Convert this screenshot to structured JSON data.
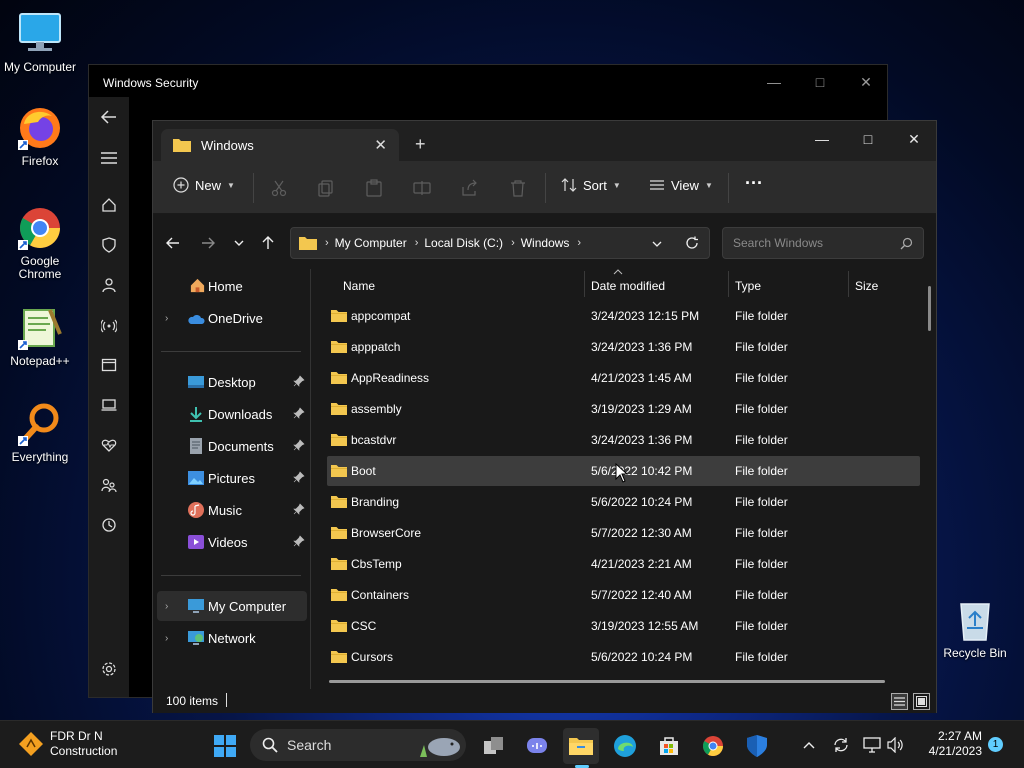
{
  "desktop": {
    "icons": [
      {
        "label": "My Computer",
        "icon": "monitor-icon"
      },
      {
        "label": "Firefox",
        "icon": "firefox-icon"
      },
      {
        "label": "Google Chrome",
        "icon": "chrome-icon"
      },
      {
        "label": "Notepad++",
        "icon": "notepadpp-icon"
      },
      {
        "label": "Everything",
        "icon": "everything-icon"
      },
      {
        "label": "Recycle Bin",
        "icon": "recycle-bin-icon"
      }
    ]
  },
  "security_window": {
    "title": "Windows Security",
    "sidebar_icons": [
      "back-arrow-icon",
      "menu-icon",
      "home-icon",
      "shield-icon",
      "account-icon",
      "wifi-icon",
      "app-browser-icon",
      "device-icon",
      "health-icon",
      "family-icon",
      "history-icon",
      "settings-icon"
    ]
  },
  "explorer": {
    "tab_title": "Windows",
    "toolbar": {
      "new_label": "New",
      "sort_label": "Sort",
      "view_label": "View",
      "more_label": "···"
    },
    "address": {
      "breadcrumbs": [
        "My Computer",
        "Local Disk (C:)",
        "Windows"
      ]
    },
    "search_placeholder": "Search Windows",
    "nav": {
      "home": "Home",
      "onedrive": "OneDrive",
      "desktop": "Desktop",
      "downloads": "Downloads",
      "documents": "Documents",
      "pictures": "Pictures",
      "music": "Music",
      "videos": "Videos",
      "my_computer": "My Computer",
      "network": "Network"
    },
    "columns": {
      "name": "Name",
      "date": "Date modified",
      "type": "Type",
      "size": "Size"
    },
    "files": [
      {
        "name": "appcompat",
        "date": "3/24/2023 12:15 PM",
        "type": "File folder"
      },
      {
        "name": "apppatch",
        "date": "3/24/2023 1:36 PM",
        "type": "File folder"
      },
      {
        "name": "AppReadiness",
        "date": "4/21/2023 1:45 AM",
        "type": "File folder"
      },
      {
        "name": "assembly",
        "date": "3/19/2023 1:29 AM",
        "type": "File folder"
      },
      {
        "name": "bcastdvr",
        "date": "3/24/2023 1:36 PM",
        "type": "File folder"
      },
      {
        "name": "Boot",
        "date": "5/6/2022 10:42 PM",
        "type": "File folder"
      },
      {
        "name": "Branding",
        "date": "5/6/2022 10:24 PM",
        "type": "File folder"
      },
      {
        "name": "BrowserCore",
        "date": "5/7/2022 12:30 AM",
        "type": "File folder"
      },
      {
        "name": "CbsTemp",
        "date": "4/21/2023 2:21 AM",
        "type": "File folder"
      },
      {
        "name": "Containers",
        "date": "5/7/2022 12:40 AM",
        "type": "File folder"
      },
      {
        "name": "CSC",
        "date": "3/19/2023 12:55 AM",
        "type": "File folder"
      },
      {
        "name": "Cursors",
        "date": "5/6/2022 10:24 PM",
        "type": "File folder"
      }
    ],
    "status": {
      "item_count": "100 items"
    }
  },
  "taskbar": {
    "weather": {
      "line1": "FDR Dr N",
      "line2": "Construction"
    },
    "search_label": "Search",
    "clock": {
      "time": "2:27 AM",
      "date": "4/21/2023"
    },
    "notification_count": "1"
  },
  "colors": {
    "folder": "#f3c74f",
    "accent": "#60cdff",
    "selected_row": "#3d3d3d"
  }
}
